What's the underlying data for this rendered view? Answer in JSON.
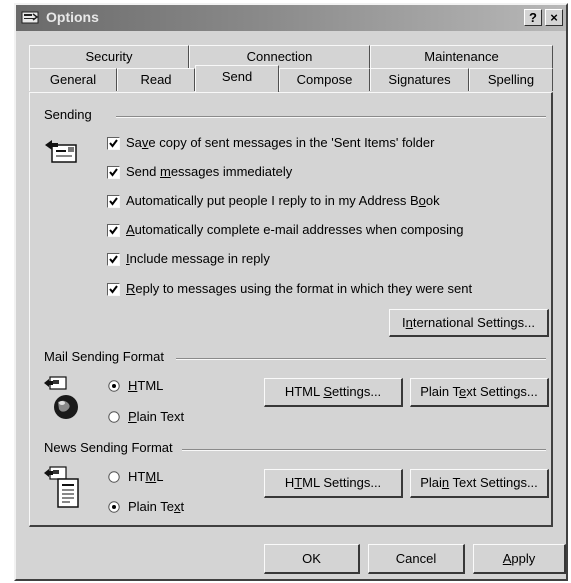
{
  "window": {
    "title": "Options",
    "help_btn": "?",
    "close_btn": "×"
  },
  "tabs": {
    "row1": [
      "Security",
      "Connection",
      "Maintenance"
    ],
    "row2": [
      "General",
      "Read",
      "Send",
      "Compose",
      "Signatures",
      "Spelling"
    ],
    "active": "Send"
  },
  "sending": {
    "group_label": "Sending",
    "icon": "outbox-envelope-icon",
    "options": [
      {
        "pre": "Sa",
        "ul": "v",
        "post": "e copy of sent messages in the 'Sent Items' folder",
        "checked": true
      },
      {
        "pre": "Send ",
        "ul": "m",
        "post": "essages immediately",
        "checked": true
      },
      {
        "pre": "Automatically put people I reply to in my Address B",
        "ul": "o",
        "post": "ok",
        "checked": true
      },
      {
        "pre": "",
        "ul": "A",
        "post": "utomatically complete e-mail addresses when composing",
        "checked": true
      },
      {
        "pre": "",
        "ul": "I",
        "post": "nclude message in reply",
        "checked": true
      },
      {
        "pre": "",
        "ul": "R",
        "post": "eply to messages using the format in which they were sent",
        "checked": true
      }
    ],
    "intl_btn": {
      "pre": "I",
      "ul": "n",
      "post": "ternational Settings..."
    }
  },
  "mail_format": {
    "group_label": "Mail Sending Format",
    "icon": "mail-globe-icon",
    "html": {
      "pre": "",
      "ul": "H",
      "post": "TML",
      "selected": true
    },
    "plain": {
      "pre": "",
      "ul": "P",
      "post": "lain Text",
      "selected": false
    },
    "html_btn": {
      "pre": "HTML ",
      "ul": "S",
      "post": "ettings..."
    },
    "plain_btn": {
      "pre": "Plain T",
      "ul": "e",
      "post": "xt Settings..."
    }
  },
  "news_format": {
    "group_label": "News Sending Format",
    "icon": "news-document-icon",
    "html": {
      "pre": "HT",
      "ul": "M",
      "post": "L",
      "selected": false
    },
    "plain": {
      "pre": "Plain Te",
      "ul": "x",
      "post": "t",
      "selected": true
    },
    "html_btn": {
      "pre": "H",
      "ul": "T",
      "post": "ML Settings..."
    },
    "plain_btn": {
      "pre": "Plai",
      "ul": "n",
      "post": " Text Settings..."
    }
  },
  "footer": {
    "ok": "OK",
    "cancel": "Cancel",
    "apply": {
      "pre": "",
      "ul": "A",
      "post": "pply"
    }
  }
}
